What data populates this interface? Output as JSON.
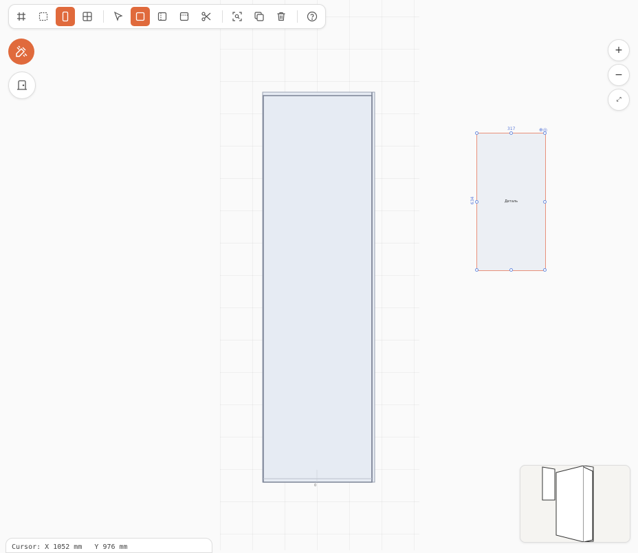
{
  "toolbar": {
    "tools": [
      {
        "icon": "hash-grid-icon",
        "active": false
      },
      {
        "icon": "dashed-square-icon",
        "active": false
      },
      {
        "icon": "door-panel-icon",
        "active": true
      },
      {
        "icon": "grid-quad-icon",
        "active": false
      },
      {
        "icon": "pointer-icon",
        "active": false
      },
      {
        "icon": "square-icon",
        "active": true
      },
      {
        "icon": "vertical-split-icon",
        "active": false
      },
      {
        "icon": "horizontal-split-icon",
        "active": false
      },
      {
        "icon": "scissors-icon",
        "active": false
      },
      {
        "icon": "zoom-fit-icon",
        "active": false
      },
      {
        "icon": "copy-icon",
        "active": false
      },
      {
        "icon": "trash-icon",
        "active": false
      },
      {
        "icon": "help-icon",
        "active": false
      }
    ]
  },
  "side_buttons": {
    "primary_icon": "edit-ruler-icon",
    "secondary_icon": "cabinet-icon"
  },
  "zoom": {
    "in_label": "+",
    "out_label": "−",
    "fit_label": "⤢"
  },
  "canvas": {
    "cabinet_bottom_label": "0"
  },
  "detail": {
    "label": "Деталь",
    "width_dim": "317",
    "height_dim": "634",
    "icons_text": "⊕◎"
  },
  "status": {
    "cursor_text": "Cursor: X 1052 mm   Y 976 mm"
  },
  "colors": {
    "accent": "#e06a3c",
    "panel_fill": "#e6ebf3",
    "panel_stroke": "#7a8294",
    "selection": "#e8907a",
    "handle": "#6b8ee0"
  }
}
